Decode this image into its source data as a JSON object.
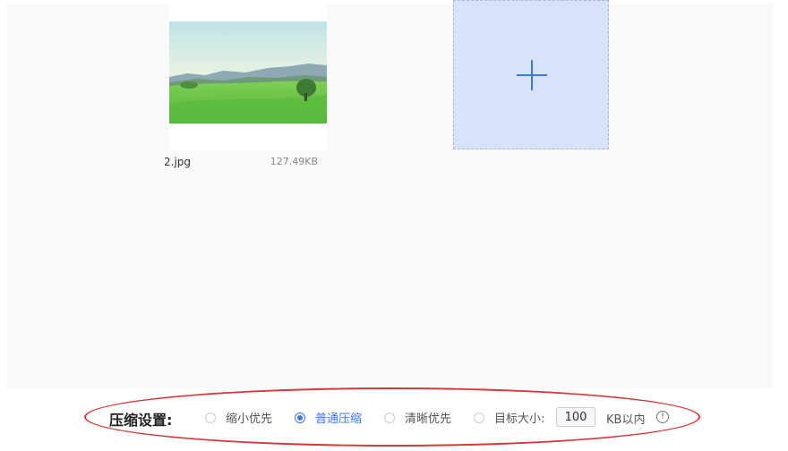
{
  "files": [
    {
      "name": "2.jpg",
      "size": "127.49KB"
    }
  ],
  "add_tile": {
    "icon": "plus-icon"
  },
  "settings": {
    "title": "压缩设置:",
    "options": [
      {
        "label": "缩小优先",
        "checked": false
      },
      {
        "label": "普通压缩",
        "checked": true
      },
      {
        "label": "清晰优先",
        "checked": false
      },
      {
        "label": "目标大小:",
        "checked": false
      }
    ],
    "target_size_value": "100",
    "target_size_unit": "KB以内",
    "info_icon": "info-icon",
    "info_glyph": "!"
  },
  "colors": {
    "accent": "#3a78e6",
    "annotation": "#d8373a",
    "panel_bg": "#f8f9fb",
    "add_tile_bg": "#d6e3fb"
  }
}
